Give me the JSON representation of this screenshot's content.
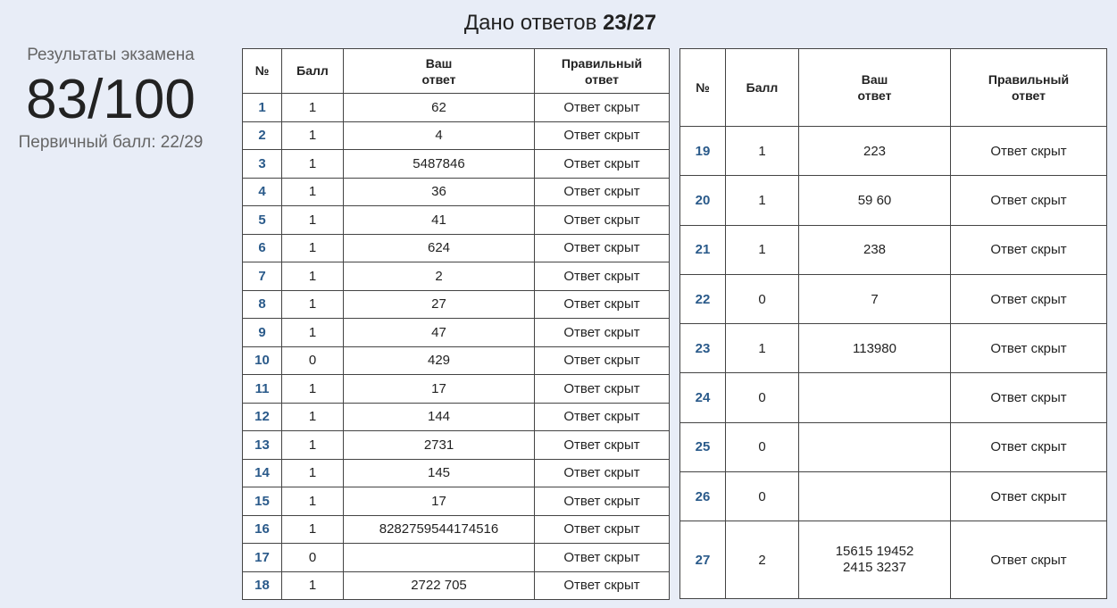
{
  "header": {
    "prefix": "Дано ответов",
    "count": "23/27"
  },
  "summary": {
    "label": "Результаты экзамена",
    "score": "83/100",
    "primary": "Первичный балл: 22/29"
  },
  "columns": {
    "num": "№",
    "points": "Балл",
    "your_answer_1": "Ваш",
    "your_answer_2": "ответ",
    "correct_1": "Правильный",
    "correct_2": "ответ"
  },
  "left_rows": [
    {
      "num": "1",
      "points": "1",
      "answer": "62",
      "correct": "Ответ скрыт"
    },
    {
      "num": "2",
      "points": "1",
      "answer": "4",
      "correct": "Ответ скрыт"
    },
    {
      "num": "3",
      "points": "1",
      "answer": "5487846",
      "correct": "Ответ скрыт"
    },
    {
      "num": "4",
      "points": "1",
      "answer": "36",
      "correct": "Ответ скрыт"
    },
    {
      "num": "5",
      "points": "1",
      "answer": "41",
      "correct": "Ответ скрыт"
    },
    {
      "num": "6",
      "points": "1",
      "answer": "624",
      "correct": "Ответ скрыт"
    },
    {
      "num": "7",
      "points": "1",
      "answer": "2",
      "correct": "Ответ скрыт"
    },
    {
      "num": "8",
      "points": "1",
      "answer": "27",
      "correct": "Ответ скрыт"
    },
    {
      "num": "9",
      "points": "1",
      "answer": "47",
      "correct": "Ответ скрыт"
    },
    {
      "num": "10",
      "points": "0",
      "answer": "429",
      "correct": "Ответ скрыт"
    },
    {
      "num": "11",
      "points": "1",
      "answer": "17",
      "correct": "Ответ скрыт"
    },
    {
      "num": "12",
      "points": "1",
      "answer": "144",
      "correct": "Ответ скрыт"
    },
    {
      "num": "13",
      "points": "1",
      "answer": "2731",
      "correct": "Ответ скрыт"
    },
    {
      "num": "14",
      "points": "1",
      "answer": "145",
      "correct": "Ответ скрыт"
    },
    {
      "num": "15",
      "points": "1",
      "answer": "17",
      "correct": "Ответ скрыт"
    },
    {
      "num": "16",
      "points": "1",
      "answer": "8282759544174516",
      "correct": "Ответ скрыт"
    },
    {
      "num": "17",
      "points": "0",
      "answer": "",
      "correct": "Ответ скрыт"
    },
    {
      "num": "18",
      "points": "1",
      "answer": "2722 705",
      "correct": "Ответ скрыт"
    }
  ],
  "right_rows": [
    {
      "num": "19",
      "points": "1",
      "answer": "223",
      "correct": "Ответ скрыт"
    },
    {
      "num": "20",
      "points": "1",
      "answer": "59 60",
      "correct": "Ответ скрыт"
    },
    {
      "num": "21",
      "points": "1",
      "answer": "238",
      "correct": "Ответ скрыт"
    },
    {
      "num": "22",
      "points": "0",
      "answer": "7",
      "correct": "Ответ скрыт"
    },
    {
      "num": "23",
      "points": "1",
      "answer": "113980",
      "correct": "Ответ скрыт"
    },
    {
      "num": "24",
      "points": "0",
      "answer": "",
      "correct": "Ответ скрыт"
    },
    {
      "num": "25",
      "points": "0",
      "answer": "",
      "correct": "Ответ скрыт"
    },
    {
      "num": "26",
      "points": "0",
      "answer": "",
      "correct": "Ответ скрыт"
    },
    {
      "num": "27",
      "points": "2",
      "answer_lines": [
        "15615 19452",
        "2415 3237"
      ],
      "correct": "Ответ скрыт"
    }
  ],
  "colors": {
    "background": "#e8edf7",
    "task_number": "#2a5a8a",
    "muted_text": "#666666"
  }
}
